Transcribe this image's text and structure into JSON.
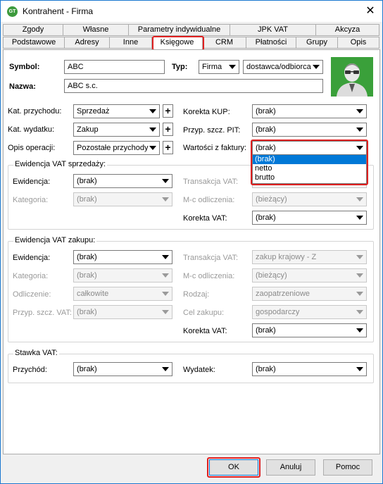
{
  "window": {
    "title": "Kontrahent - Firma",
    "close_label": "✕",
    "icon_label": "GT"
  },
  "tabs_row1": [
    "Zgody",
    "Własne",
    "Parametry indywidualne",
    "JPK VAT",
    "Akcyza"
  ],
  "tabs_row2": [
    "Podstawowe",
    "Adresy",
    "Inne",
    "Księgowe",
    "CRM",
    "Płatności",
    "Grupy",
    "Opis"
  ],
  "header": {
    "symbol_label": "Symbol:",
    "symbol_value": "ABC",
    "typ_label": "Typ:",
    "typ_value": "Firma",
    "rodzaj_value": "dostawca/odbiorca",
    "nazwa_label": "Nazwa:",
    "nazwa_value": "ABC s.c."
  },
  "left": {
    "kat_przychodu_label": "Kat. przychodu:",
    "kat_przychodu_value": "Sprzedaż",
    "kat_wydatku_label": "Kat. wydatku:",
    "kat_wydatku_value": "Zakup",
    "opis_label": "Opis operacji:",
    "opis_value": "Pozostałe przychody",
    "plus": "+"
  },
  "right": {
    "korekta_kup_label": "Korekta KUP:",
    "korekta_kup_value": "(brak)",
    "przyp_pit_label": "Przyp. szcz. PIT:",
    "przyp_pit_value": "(brak)",
    "wartosci_label": "Wartości z faktury:",
    "wartosci_value": "(brak)"
  },
  "dropdown_options": [
    "(brak)",
    "netto",
    "brutto"
  ],
  "vat_sprzedazy": {
    "title": "Ewidencja VAT sprzedaży:",
    "ewidencja_label": "Ewidencja:",
    "ewidencja_value": "(brak)",
    "kategoria_label": "Kategoria:",
    "kategoria_value": "(brak)",
    "transakcja_label": "Transakcja VAT:",
    "mc_label": "M-c odliczenia:",
    "mc_value": "(bieżący)",
    "korekta_label": "Korekta VAT:",
    "korekta_value": "(brak)"
  },
  "vat_zakupu": {
    "title": "Ewidencja VAT zakupu:",
    "ewidencja_label": "Ewidencja:",
    "ewidencja_value": "(brak)",
    "kategoria_label": "Kategoria:",
    "kategoria_value": "(brak)",
    "odliczenie_label": "Odliczenie:",
    "odliczenie_value": "całkowite",
    "przyp_label": "Przyp. szcz. VAT:",
    "przyp_value": "(brak)",
    "transakcja_label": "Transakcja VAT:",
    "transakcja_value": "zakup krajowy - Z",
    "mc_label": "M-c odliczenia:",
    "mc_value": "(bieżący)",
    "rodzaj_label": "Rodzaj:",
    "rodzaj_value": "zaopatrzeniowe",
    "cel_label": "Cel zakupu:",
    "cel_value": "gospodarczy",
    "korekta_label": "Korekta VAT:",
    "korekta_value": "(brak)"
  },
  "stawka": {
    "title": "Stawka VAT:",
    "przychod_label": "Przychód:",
    "przychod_value": "(brak)",
    "wydatek_label": "Wydatek:",
    "wydatek_value": "(brak)"
  },
  "buttons": {
    "ok": "OK",
    "cancel": "Anuluj",
    "help": "Pomoc"
  }
}
